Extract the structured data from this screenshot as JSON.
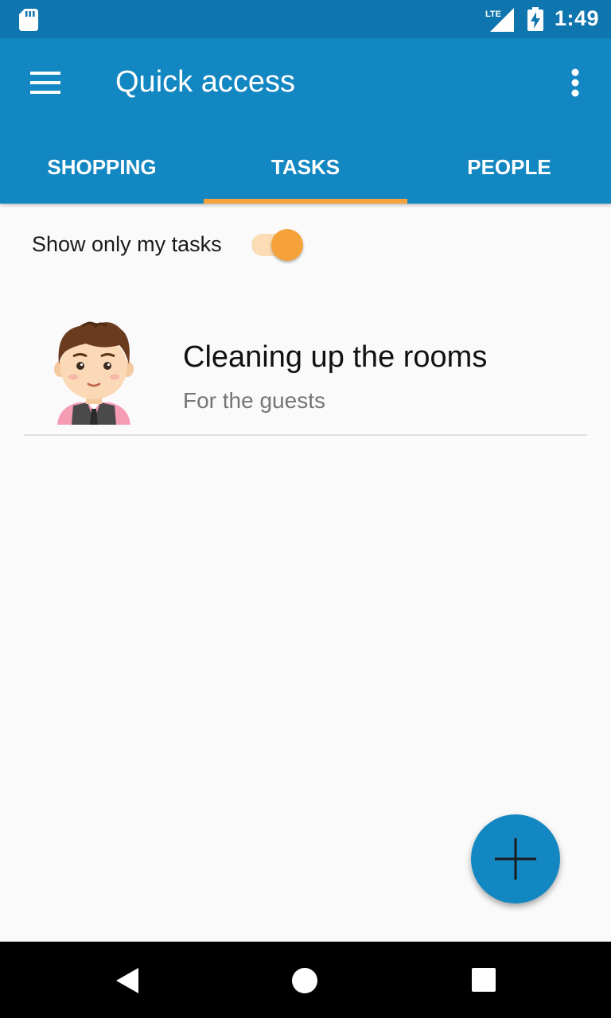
{
  "status_bar": {
    "time": "1:49",
    "network_label": "LTE",
    "icons": [
      "sd-card-icon",
      "lte-signal-icon",
      "battery-charging-icon"
    ]
  },
  "app_bar": {
    "title": "Quick access",
    "menu_icon": "hamburger-menu-icon",
    "overflow_icon": "more-vert-icon"
  },
  "tabs": [
    {
      "label": "SHOPPING",
      "selected": false
    },
    {
      "label": "TASKS",
      "selected": true
    },
    {
      "label": "PEOPLE",
      "selected": false
    }
  ],
  "filter": {
    "label": "Show only my tasks",
    "enabled": true
  },
  "tasks": [
    {
      "title": "Cleaning up the rooms",
      "subtitle": "For the guests",
      "avatar": "person-avatar"
    }
  ],
  "fab": {
    "icon": "add-icon"
  },
  "navigation": {
    "icons": [
      "back-icon",
      "home-icon",
      "recents-icon"
    ]
  },
  "colors": {
    "primary": "#1387c1",
    "primary_dark": "#0f75ae",
    "accent": "#f6a23a",
    "background": "#fafafa"
  }
}
